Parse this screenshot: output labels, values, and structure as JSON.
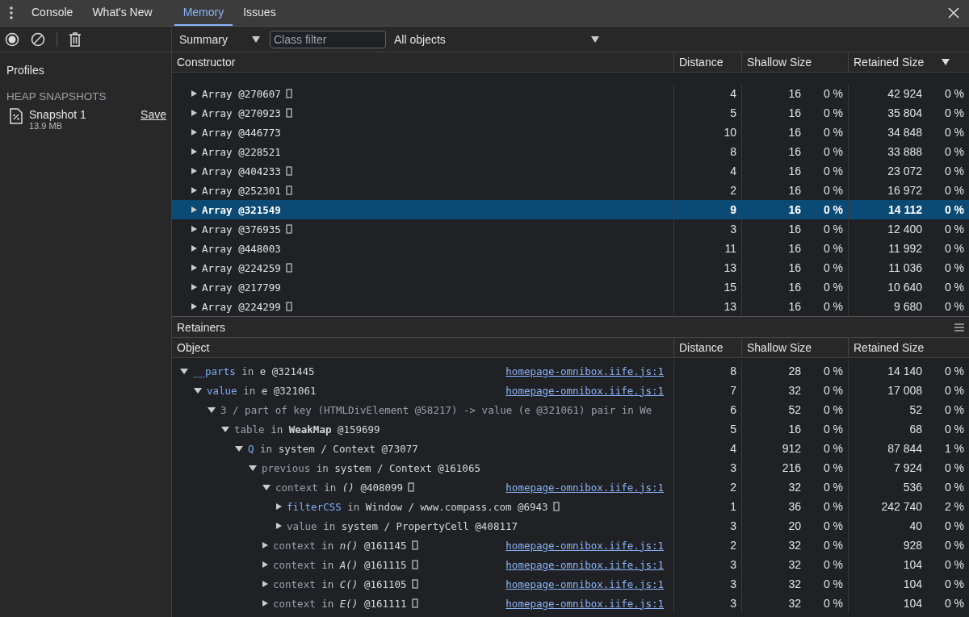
{
  "tabs": [
    {
      "label": "Console",
      "selected": false
    },
    {
      "label": "What's New",
      "selected": false
    },
    {
      "label": "Memory",
      "selected": true
    },
    {
      "label": "Issues",
      "selected": false
    }
  ],
  "toolbar": {
    "view": "Summary",
    "class_filter": {
      "placeholder": "Class filter"
    },
    "scope": "All objects"
  },
  "sidebar": {
    "title": "Profiles",
    "section": "HEAP SNAPSHOTS",
    "snapshots": [
      {
        "name": "Snapshot 1",
        "size": "13.9 MB",
        "action": "Save"
      }
    ]
  },
  "summary": {
    "columns": [
      {
        "label": "Constructor",
        "sorted": false
      },
      {
        "label": "Distance",
        "sorted": false
      },
      {
        "label": "Shallow Size",
        "sorted": false
      },
      {
        "label": "Retained Size",
        "sorted": true
      }
    ],
    "rows": [
      {
        "name": "Array",
        "id": "@270607",
        "flag": true,
        "expanded": false,
        "selected": false,
        "distance": "4",
        "shallow": "16",
        "shallow_pct": "0 %",
        "retained": "42 924",
        "retained_pct": "0 %"
      },
      {
        "name": "Array",
        "id": "@270923",
        "flag": true,
        "expanded": false,
        "selected": false,
        "distance": "5",
        "shallow": "16",
        "shallow_pct": "0 %",
        "retained": "35 804",
        "retained_pct": "0 %"
      },
      {
        "name": "Array",
        "id": "@446773",
        "flag": false,
        "expanded": false,
        "selected": false,
        "distance": "10",
        "shallow": "16",
        "shallow_pct": "0 %",
        "retained": "34 848",
        "retained_pct": "0 %"
      },
      {
        "name": "Array",
        "id": "@228521",
        "flag": false,
        "expanded": false,
        "selected": false,
        "distance": "8",
        "shallow": "16",
        "shallow_pct": "0 %",
        "retained": "33 888",
        "retained_pct": "0 %"
      },
      {
        "name": "Array",
        "id": "@404233",
        "flag": true,
        "expanded": false,
        "selected": false,
        "distance": "4",
        "shallow": "16",
        "shallow_pct": "0 %",
        "retained": "23 072",
        "retained_pct": "0 %"
      },
      {
        "name": "Array",
        "id": "@252301",
        "flag": true,
        "expanded": false,
        "selected": false,
        "distance": "2",
        "shallow": "16",
        "shallow_pct": "0 %",
        "retained": "16 972",
        "retained_pct": "0 %"
      },
      {
        "name": "Array",
        "id": "@321549",
        "flag": false,
        "expanded": false,
        "selected": true,
        "distance": "9",
        "shallow": "16",
        "shallow_pct": "0 %",
        "retained": "14 112",
        "retained_pct": "0 %"
      },
      {
        "name": "Array",
        "id": "@376935",
        "flag": true,
        "expanded": false,
        "selected": false,
        "distance": "3",
        "shallow": "16",
        "shallow_pct": "0 %",
        "retained": "12 400",
        "retained_pct": "0 %"
      },
      {
        "name": "Array",
        "id": "@448003",
        "flag": false,
        "expanded": false,
        "selected": false,
        "distance": "11",
        "shallow": "16",
        "shallow_pct": "0 %",
        "retained": "11 992",
        "retained_pct": "0 %"
      },
      {
        "name": "Array",
        "id": "@224259",
        "flag": true,
        "expanded": false,
        "selected": false,
        "distance": "13",
        "shallow": "16",
        "shallow_pct": "0 %",
        "retained": "11 036",
        "retained_pct": "0 %"
      },
      {
        "name": "Array",
        "id": "@217799",
        "flag": false,
        "expanded": false,
        "selected": false,
        "distance": "15",
        "shallow": "16",
        "shallow_pct": "0 %",
        "retained": "10 640",
        "retained_pct": "0 %"
      },
      {
        "name": "Array",
        "id": "@224299",
        "flag": true,
        "expanded": false,
        "selected": false,
        "distance": "13",
        "shallow": "16",
        "shallow_pct": "0 %",
        "retained": "9 680",
        "retained_pct": "0 %"
      }
    ]
  },
  "retainers": {
    "title": "Retainers",
    "columns": [
      "Object",
      "Distance",
      "Shallow Size",
      "Retained Size"
    ],
    "rows": [
      {
        "edge": "__parts",
        "kind": "property",
        "sep": "in",
        "object": "e @321445",
        "flag": false,
        "link": "homepage-omnibox.iife.js:1",
        "expanded": true,
        "distance": "8",
        "shallow": "28",
        "shallow_pct": "0 %",
        "retained": "14 140",
        "retained_pct": "0 %",
        "children": [
          {
            "edge": "value",
            "kind": "property",
            "sep": "in",
            "object": "e @321061",
            "flag": false,
            "link": "homepage-omnibox.iife.js:1",
            "expanded": true,
            "distance": "7",
            "shallow": "32",
            "shallow_pct": "0 %",
            "retained": "17 008",
            "retained_pct": "0 %",
            "children": [
              {
                "edge": "3 / part of key (HTMLDivElement @58217) -> value (e @321061) pair in We",
                "kind": "internal",
                "flag": false,
                "expanded": true,
                "distance": "6",
                "shallow": "52",
                "shallow_pct": "0 %",
                "retained": "52",
                "retained_pct": "0 %",
                "children": [
                  {
                    "edge": "table",
                    "kind": "internal",
                    "sep": "in",
                    "object": "**WeakMap** @159699",
                    "flag": false,
                    "expanded": true,
                    "distance": "5",
                    "shallow": "16",
                    "shallow_pct": "0 %",
                    "retained": "68",
                    "retained_pct": "0 %",
                    "children": [
                      {
                        "edge": "Q",
                        "kind": "property",
                        "sep": "in",
                        "object": "system / Context @73077",
                        "flag": false,
                        "expanded": true,
                        "distance": "4",
                        "shallow": "912",
                        "shallow_pct": "0 %",
                        "retained": "87 844",
                        "retained_pct": "1 %",
                        "children": [
                          {
                            "edge": "previous",
                            "kind": "internal",
                            "sep": "in",
                            "object": "system / Context @161065",
                            "flag": false,
                            "expanded": true,
                            "distance": "3",
                            "shallow": "216",
                            "shallow_pct": "0 %",
                            "retained": "7 924",
                            "retained_pct": "0 %",
                            "children": [
                              {
                                "edge": "context",
                                "kind": "internal",
                                "sep": "in",
                                "object": "*()* @408099",
                                "flag": true,
                                "link": "homepage-omnibox.iife.js:1",
                                "expanded": true,
                                "distance": "2",
                                "shallow": "32",
                                "shallow_pct": "0 %",
                                "retained": "536",
                                "retained_pct": "0 %",
                                "children": [
                                  {
                                    "edge": "filterCSS",
                                    "kind": "property",
                                    "sep": "in",
                                    "object": "Window / www.compass.com @6943",
                                    "flag": true,
                                    "expanded": false,
                                    "distance": "1",
                                    "shallow": "36",
                                    "shallow_pct": "0 %",
                                    "retained": "242 740",
                                    "retained_pct": "2 %"
                                  },
                                  {
                                    "edge": "value",
                                    "kind": "internal",
                                    "sep": "in",
                                    "object": "system / PropertyCell @408117",
                                    "flag": false,
                                    "expanded": false,
                                    "distance": "3",
                                    "shallow": "20",
                                    "shallow_pct": "0 %",
                                    "retained": "40",
                                    "retained_pct": "0 %"
                                  }
                                ]
                              },
                              {
                                "edge": "context",
                                "kind": "internal",
                                "sep": "in",
                                "object": "*n()* @161145",
                                "flag": true,
                                "link": "homepage-omnibox.iife.js:1",
                                "expanded": false,
                                "distance": "2",
                                "shallow": "32",
                                "shallow_pct": "0 %",
                                "retained": "928",
                                "retained_pct": "0 %"
                              },
                              {
                                "edge": "context",
                                "kind": "internal",
                                "sep": "in",
                                "object": "*A()* @161115",
                                "flag": true,
                                "link": "homepage-omnibox.iife.js:1",
                                "expanded": false,
                                "distance": "3",
                                "shallow": "32",
                                "shallow_pct": "0 %",
                                "retained": "104",
                                "retained_pct": "0 %"
                              },
                              {
                                "edge": "context",
                                "kind": "internal",
                                "sep": "in",
                                "object": "*C()* @161105",
                                "flag": true,
                                "link": "homepage-omnibox.iife.js:1",
                                "expanded": false,
                                "distance": "3",
                                "shallow": "32",
                                "shallow_pct": "0 %",
                                "retained": "104",
                                "retained_pct": "0 %"
                              },
                              {
                                "edge": "context",
                                "kind": "internal",
                                "sep": "in",
                                "object": "*E()* @161111",
                                "flag": true,
                                "link": "homepage-omnibox.iife.js:1",
                                "expanded": false,
                                "distance": "3",
                                "shallow": "32",
                                "shallow_pct": "0 %",
                                "retained": "104",
                                "retained_pct": "0 %"
                              }
                            ]
                          }
                        ]
                      }
                    ]
                  }
                ]
              }
            ]
          }
        ]
      }
    ]
  }
}
